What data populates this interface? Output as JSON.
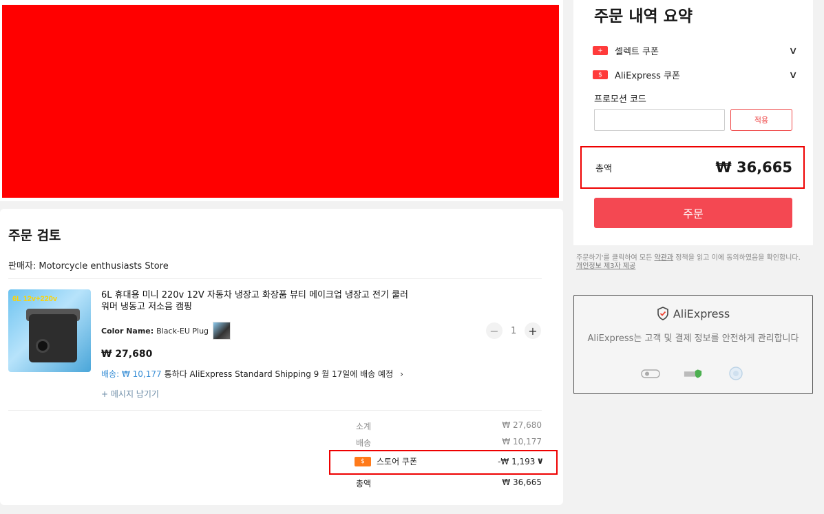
{
  "review": {
    "title": "주문 검토",
    "seller": "판매자: Motorcycle enthusiasts Store",
    "product": {
      "image_text": "6L 12v+220v",
      "title": "6L 휴대용 미니 220v 12V 자동차 냉장고 화장품 뷰티 메이크업 냉장고 전기 쿨러 워머 냉동고 저소음 캠핑",
      "color_label": "Color Name:",
      "color_value": "Black-EU Plug",
      "qty_minus": "−",
      "qty_value": "1",
      "qty_plus": "+",
      "price": "₩ 27,680",
      "shipping_label": "배송: ₩ 10,177",
      "shipping_text": "통하다 AliExpress Standard Shipping 9 월 17일에 배송 예정",
      "shipping_chevron": "›",
      "leave_message": "+ 메시지 남기기"
    },
    "summary": {
      "subtotal_label": "소계",
      "subtotal_value": "₩ 27,680",
      "shipping_label": "배송",
      "shipping_value": "₩ 10,177",
      "coupon_icon": "$",
      "coupon_label": "스토어 쿠폰",
      "coupon_value": "-₩ 1,193",
      "coupon_chevron": "∨",
      "total_label": "총액",
      "total_value": "₩ 36,665"
    }
  },
  "order_summary": {
    "title": "주문 내역 요약",
    "select_coupon_icon": "+",
    "select_coupon": "셀렉트 쿠폰",
    "ali_coupon_icon": "$",
    "ali_coupon": "AliExpress 쿠폰",
    "chevron": "∨",
    "promo_label": "프로모션 코드",
    "promo_placeholder": "",
    "apply": "적용",
    "total_label": "총액",
    "total_value": "₩ 36,665",
    "order_button": "주문"
  },
  "terms": {
    "line1_pre": "주문하기'를 클릭하여 모든 ",
    "line1_link": "약관과",
    "line1_post": " 정책을 읽고 이에 동의하였음을 확인합니다.",
    "privacy_link": "개인정보 제3자 제공"
  },
  "secure": {
    "brand": "AliExpress",
    "text": "AliExpress는 고객 및 결제 정보를 안전하게 관리합니다"
  },
  "colors": {
    "accent_red": "#f44852",
    "banner_red": "#ff0000",
    "link_blue": "#3a8fd6"
  }
}
